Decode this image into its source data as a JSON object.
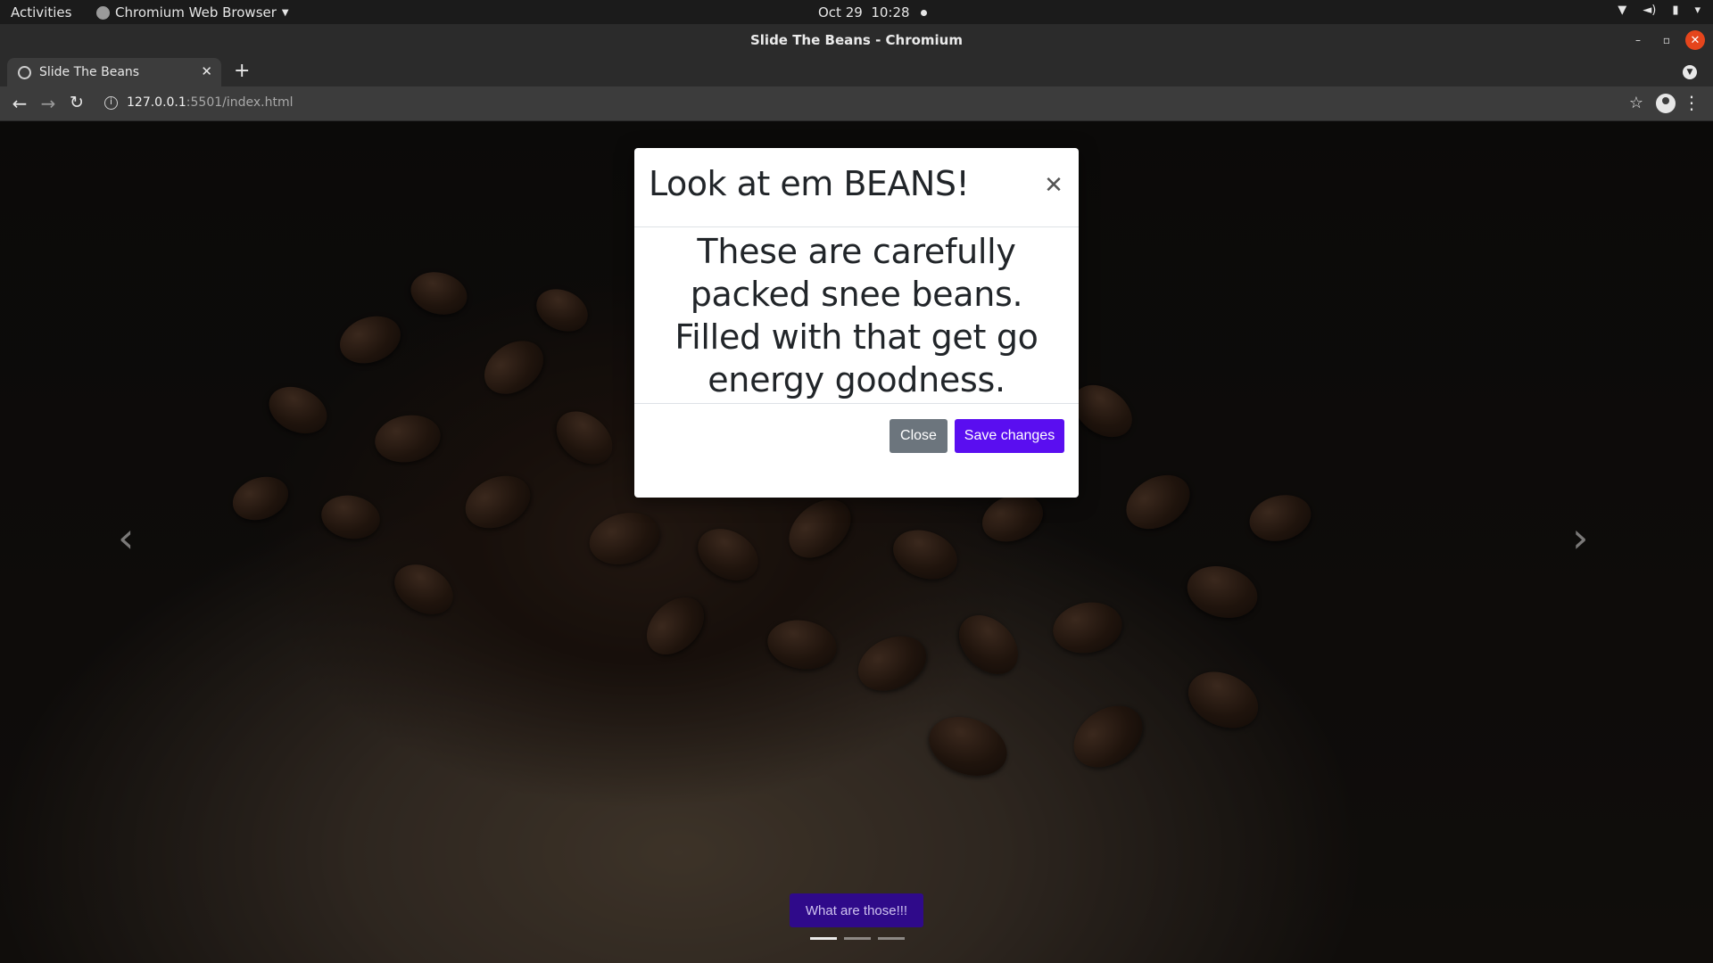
{
  "system_bar": {
    "activities": "Activities",
    "app_name": "Chromium Web Browser",
    "date": "Oct 29",
    "time": "10:28"
  },
  "window": {
    "title": "Slide The Beans - Chromium"
  },
  "tab": {
    "label": "Slide The Beans"
  },
  "address_bar": {
    "host": "127.0.0.1",
    "path": ":5501/index.html"
  },
  "modal": {
    "title": "Look at em BEANS!",
    "body": "These are carefully packed snee beans. Filled with that get go energy goodness.",
    "close_button": "Close",
    "save_button": "Save changes"
  },
  "carousel": {
    "caption_button": "What are those!!!",
    "slide_count": 3,
    "active_slide": 1
  },
  "colors": {
    "primary": "#5a0ef0",
    "secondary": "#6c757d",
    "caption_bg": "#2f0a8a"
  }
}
